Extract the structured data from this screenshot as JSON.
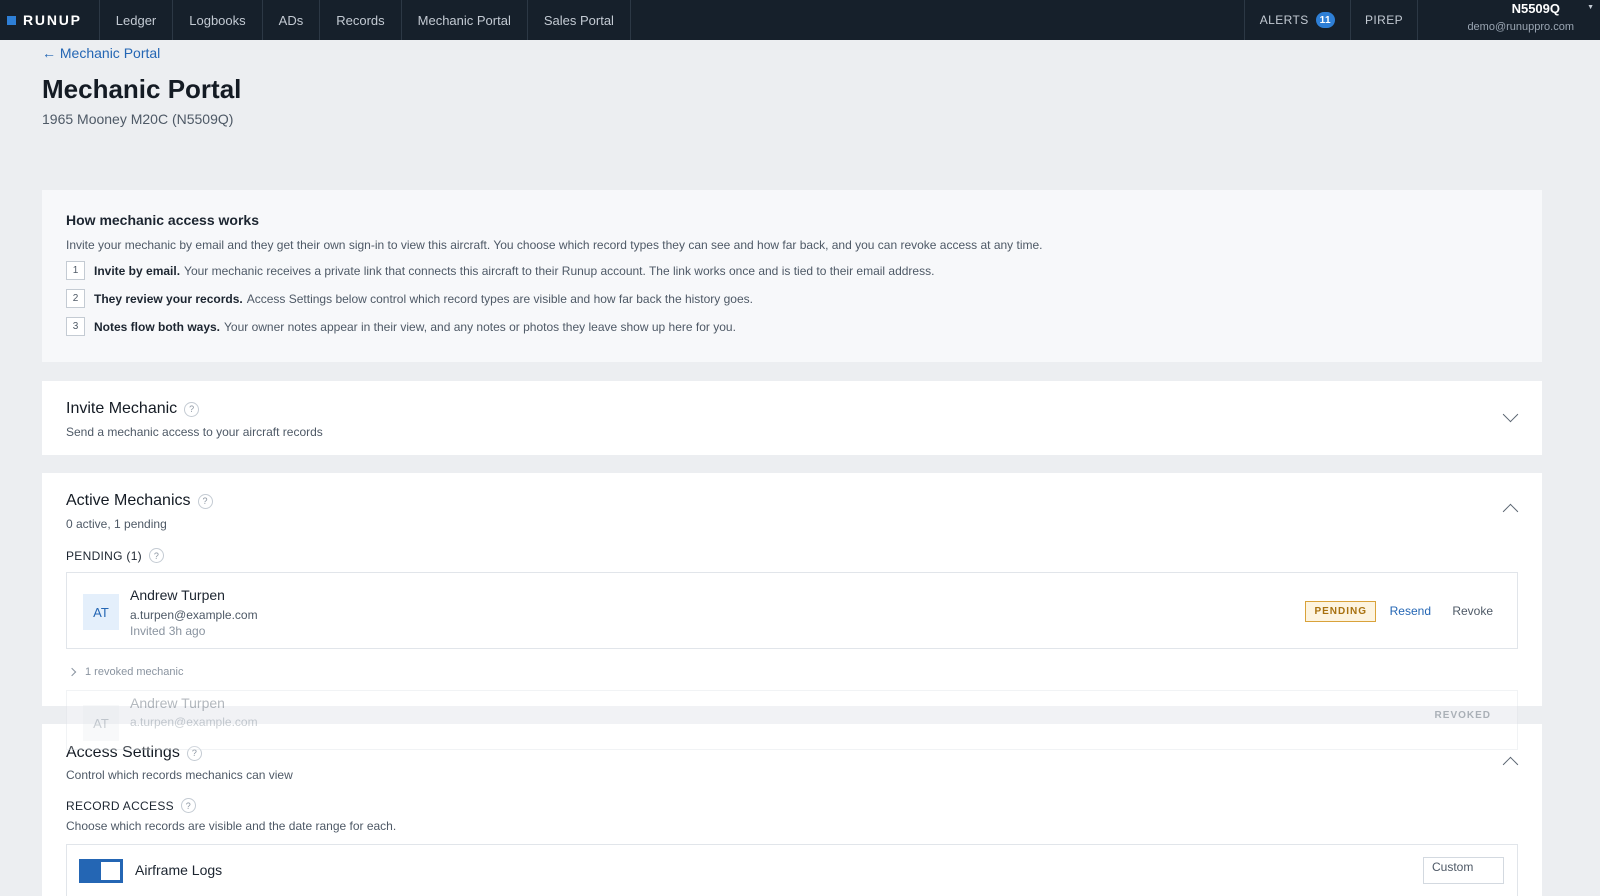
{
  "nav": {
    "brand": "RUNUP",
    "items": [
      {
        "label": "Ledger"
      },
      {
        "label": "Logbooks"
      },
      {
        "label": "ADs"
      },
      {
        "label": "Records"
      },
      {
        "label": "Mechanic Portal"
      },
      {
        "label": "Sales Portal"
      }
    ],
    "alerts_label": "ALERTS",
    "alerts_count": "11",
    "pirep_label": "PIREP",
    "account_tail": "N5509Q",
    "account_email": "demo@runuppro.com"
  },
  "header": {
    "back_link": "← Mechanic Portal",
    "title": "Mechanic Portal",
    "subtitle": "1965 Mooney M20C (N5509Q)"
  },
  "info": {
    "title": "How mechanic access works",
    "description": "Invite your mechanic by email and they get their own sign-in to view this aircraft. You choose which record types they can see and how far back, and you can revoke access at any time.",
    "steps": [
      {
        "num": "1",
        "bold": "Invite by email.",
        "text": "Your mechanic receives a private link that connects this aircraft to their Runup account. The link works once and is tied to their email address."
      },
      {
        "num": "2",
        "bold": "They review your records.",
        "text": "Access Settings below control which record types are visible and how far back the history goes."
      },
      {
        "num": "3",
        "bold": "Notes flow both ways.",
        "text": "Your owner notes appear in their view, and any notes or photos they leave show up here for you."
      }
    ]
  },
  "invite": {
    "title": "Invite Mechanic",
    "subtitle": "Send a mechanic access to your aircraft records"
  },
  "active": {
    "title": "Active Mechanics",
    "subtitle": "0 active, 1 pending",
    "pending_label": "PENDING (1)",
    "pending": {
      "initials": "AT",
      "name": "Andrew Turpen",
      "email": "a.turpen@example.com",
      "invited": "Invited 3h ago",
      "badge": "PENDING",
      "resend": "Resend",
      "revoke": "Revoke"
    },
    "revoked_toggle": "1 revoked mechanic",
    "revoked": {
      "initials": "AT",
      "name": "Andrew Turpen",
      "email": "a.turpen@example.com",
      "badge": "REVOKED"
    }
  },
  "access": {
    "title": "Access Settings",
    "subtitle": "Control which records mechanics can view",
    "record_access_label": "RECORD ACCESS",
    "record_access_desc": "Choose which records are visible and the date range for each.",
    "records": [
      {
        "name": "Airframe Logs",
        "enabled": true,
        "range": "Custom"
      }
    ]
  },
  "colors": {
    "nav_bg": "#16202b",
    "accent": "#2466b4",
    "pending_border": "#d9a23a"
  }
}
